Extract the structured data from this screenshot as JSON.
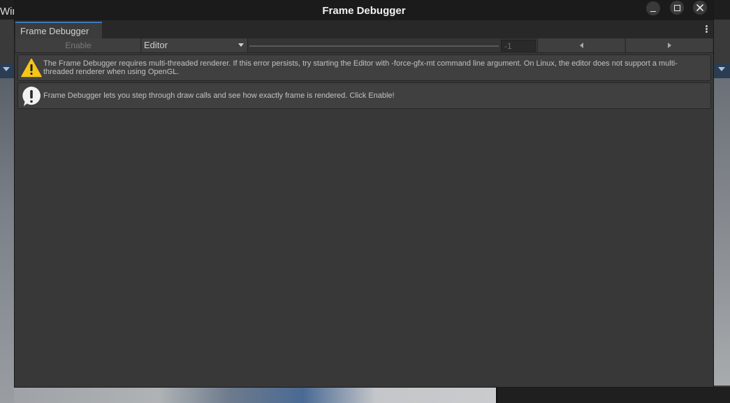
{
  "background": {
    "window_menu_fragment": "Win"
  },
  "window": {
    "title": "Frame Debugger",
    "tab_label": "Frame Debugger"
  },
  "toolbar": {
    "enable_label": "Enable",
    "target_selected": "Editor",
    "event_index": "-1"
  },
  "messages": {
    "warning": "The Frame Debugger requires multi-threaded renderer. If this error persists, try starting the Editor with -force-gfx-mt command line argument. On Linux, the editor does not support a multi-threaded renderer when using OpenGL.",
    "info": "Frame Debugger lets you step through draw calls and see how exactly frame is rendered. Click Enable!"
  },
  "icons": {
    "minimize": "minimize-icon",
    "maximize": "maximize-icon",
    "close": "close-icon",
    "more": "more-vertical-icon",
    "dropdown": "chevron-down-icon",
    "prev": "chevron-left-icon",
    "next": "chevron-right-icon",
    "warning": "warning-icon",
    "info": "info-icon"
  },
  "colors": {
    "accent_tab": "#3a79bb",
    "warning": "#f5c518",
    "info": "#f2f2f2"
  }
}
